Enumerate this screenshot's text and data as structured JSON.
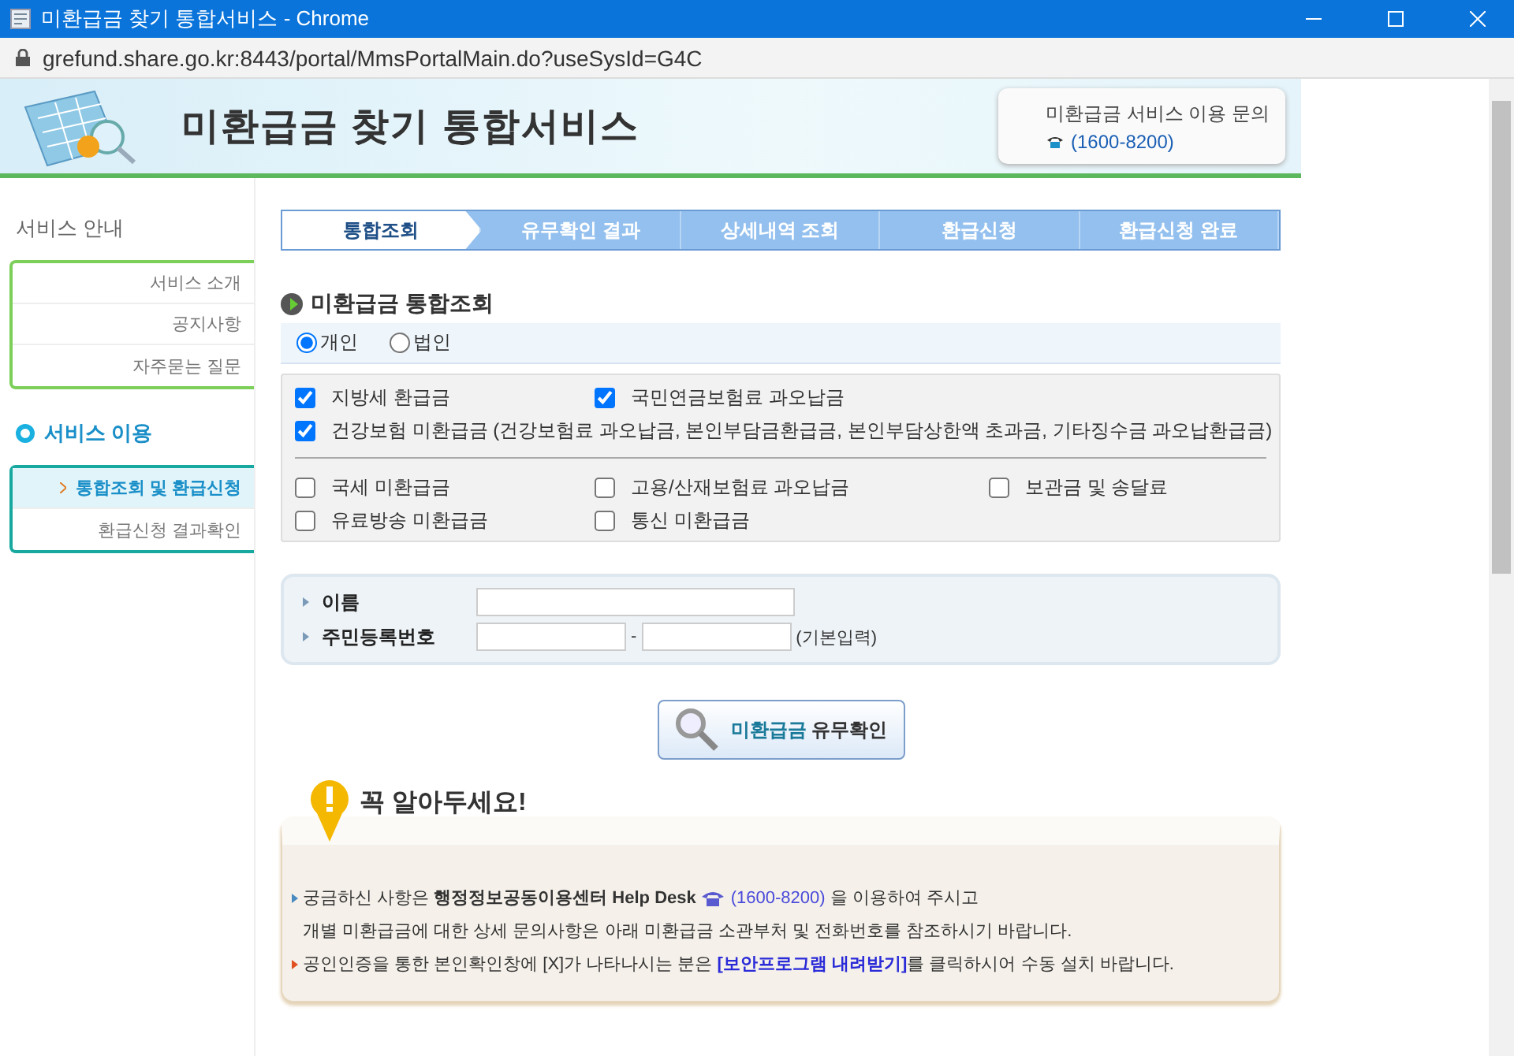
{
  "browser": {
    "title": "미환급금 찾기 통합서비스 - Chrome",
    "url": "grefund.share.go.kr:8443/portal/MmsPortalMain.do?useSysId=G4C"
  },
  "header": {
    "title": "미환급금 찾기 통합서비스",
    "contact_label": "미환급금 서비스 이용 문의",
    "contact_phone": "(1600-8200)"
  },
  "sidebar": [
    {
      "title": "서비스 안내",
      "kind": "plain",
      "items": [
        {
          "label": "서비스 소개",
          "selected": false
        },
        {
          "label": "공지사항",
          "selected": false
        },
        {
          "label": "자주묻는 질문",
          "selected": false
        }
      ]
    },
    {
      "title": "서비스 이용",
      "kind": "active",
      "items": [
        {
          "label": "통합조회 및 환급신청",
          "selected": true
        },
        {
          "label": "환급신청 결과확인",
          "selected": false
        }
      ]
    }
  ],
  "steps": [
    {
      "label": "통합조회",
      "selected": true
    },
    {
      "label": "유무확인 결과",
      "selected": false
    },
    {
      "label": "상세내역 조회",
      "selected": false
    },
    {
      "label": "환급신청",
      "selected": false
    },
    {
      "label": "환급신청 완료",
      "selected": false
    }
  ],
  "section_title": "미환급금 통합조회",
  "person_types": [
    {
      "label": "개인",
      "selected": true
    },
    {
      "label": "법인",
      "selected": false
    }
  ],
  "refund_main": [
    {
      "label": "지방세 환급금",
      "checked": true,
      "kind": "normal"
    },
    {
      "label": "국민연금보험료 과오납금",
      "checked": true,
      "kind": "normal"
    },
    {
      "label": "건강보험 미환급금 (건강보험료 과오납금, 본인부담금환급금, 본인부담상한액 초과금, 기타징수금 과오납환급금)",
      "checked": true,
      "kind": "wide"
    }
  ],
  "refund_other": [
    {
      "label": "국세 미환급금",
      "checked": false
    },
    {
      "label": "고용/산재보험료 과오납금",
      "checked": false
    },
    {
      "label": "보관금 및 송달료",
      "checked": false
    },
    {
      "label": "유료방송 미환급금",
      "checked": false
    },
    {
      "label": "통신 미환급금",
      "checked": false
    }
  ],
  "form": {
    "name_label": "이름",
    "id_label": "주민등록번호",
    "id_separator": "-",
    "id_hint": "(기본입력)"
  },
  "search_button": {
    "highlight": "미환급금",
    "label": "유무확인"
  },
  "notice": {
    "title": "꼭 알아두세요!",
    "items": [
      {
        "kind": "info",
        "text": "궁금하신 사항은 **행정정보공동이용센터 Help Desk**",
        "phone": "(1600-8200)",
        "after": "을 이용하여 주시고",
        "continuation": "개별 미환급금에 대한 상세 문의사항은 아래 미환급금 소관부처 및 전화번호를 참조하시기 바랍니다."
      },
      {
        "kind": "warning",
        "text": "공인인증을 통한 본인확인창에 [X]가 나타나시는 분은 ",
        "link": "[보안프로그램 내려받기]",
        "after": "를 클릭하시어 수동 설치 바랍니다."
      }
    ]
  }
}
